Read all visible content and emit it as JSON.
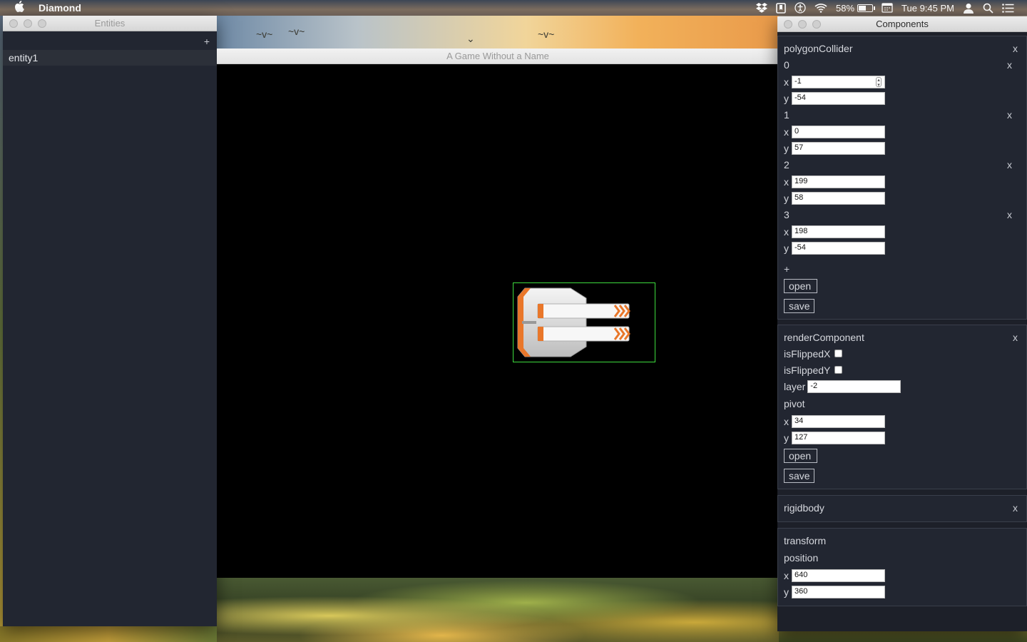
{
  "menubar": {
    "apple": "",
    "app_name": "Diamond",
    "battery": "58%",
    "clock": "Tue 9:45 PM",
    "battery_level": 0.58,
    "icons": [
      "dropbox-icon",
      "bookmark-icon",
      "accessibility-icon",
      "wifi-icon",
      "battery-icon",
      "calendar-icon",
      "user-icon",
      "search-icon",
      "list-icon"
    ]
  },
  "entities_window": {
    "title": "Entities",
    "add_label": "+",
    "items": [
      "entity1"
    ]
  },
  "game_window": {
    "title": "A Game Without a Name"
  },
  "components_window": {
    "title": "Components",
    "polygon_collider": {
      "name": "polygonCollider",
      "remove": "x",
      "points": [
        {
          "index": "0",
          "x": "-1",
          "y": "-54"
        },
        {
          "index": "1",
          "x": "0",
          "y": "57"
        },
        {
          "index": "2",
          "x": "199",
          "y": "58"
        },
        {
          "index": "3",
          "x": "198",
          "y": "-54"
        }
      ],
      "x_label": "x",
      "y_label": "y",
      "add": "+",
      "open": "open",
      "save": "save"
    },
    "render_component": {
      "name": "renderComponent",
      "remove": "x",
      "flip_x_label": "isFlippedX",
      "flip_y_label": "isFlippedY",
      "layer_label": "layer",
      "layer_value": "-2",
      "pivot_label": "pivot",
      "pivot_x": "34",
      "pivot_y": "127",
      "x_label": "x",
      "y_label": "y",
      "open": "open",
      "save": "save"
    },
    "rigidbody": {
      "name": "rigidbody",
      "remove": "x"
    },
    "transform": {
      "name": "transform",
      "position_label": "position",
      "x_label": "x",
      "y_label": "y",
      "position_x": "640",
      "position_y": "360"
    }
  }
}
